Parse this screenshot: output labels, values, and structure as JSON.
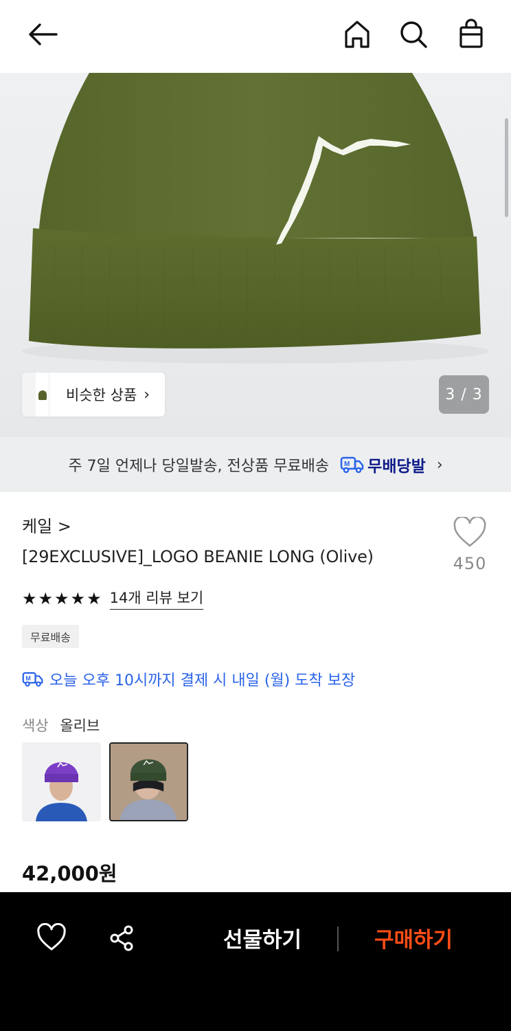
{
  "hero": {
    "similar_label": "비슷한 상품",
    "pager": "3 / 3",
    "shipping_notice": "주 7일 언제나 당일발송, 전상품 무료배송",
    "shipping_brand": "무배당발"
  },
  "product": {
    "brand": "케일 >",
    "title": "[29EXCLUSIVE]_LOGO BEANIE LONG (Olive)",
    "like_count": "450",
    "rating_stars": "★★★★★",
    "review_link": "14개 리뷰 보기",
    "badge": "무료배송",
    "delivery_guarantee": "오늘 오후 10시까지 결제 시 내일 (월) 도착 보장",
    "color_label": "색상",
    "color_value": "올리브",
    "price": "42,000원"
  },
  "bottom_bar": {
    "gift_label": "선물하기",
    "buy_label": "구매하기"
  },
  "colors": {
    "accent_buy": "#ff4d16",
    "delivery_blue": "#2a63e9",
    "brand_navy": "#0f1c8a",
    "beanie_olive": "#5b6b2d"
  },
  "icons": [
    "back-arrow-icon",
    "home-icon",
    "search-icon",
    "shopping-bag-icon",
    "heart-icon",
    "share-icon",
    "truck-icon",
    "chevron-right-icon"
  ]
}
